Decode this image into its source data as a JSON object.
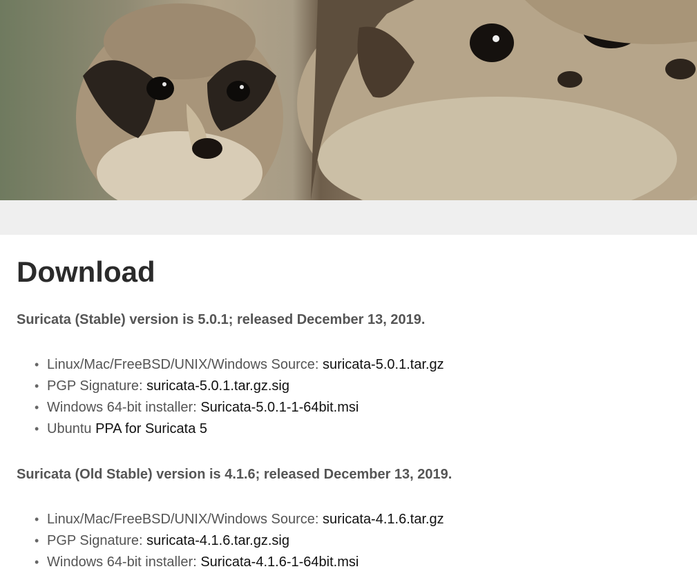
{
  "header": {
    "banner_alt": "meerkats"
  },
  "page": {
    "title": "Download"
  },
  "releases": [
    {
      "heading": "Suricata (Stable) version is 5.0.1; released December 13, 2019.",
      "items": [
        {
          "label": "Linux/Mac/FreeBSD/UNIX/Windows Source: ",
          "link": "suricata-5.0.1.tar.gz"
        },
        {
          "label": "PGP Signature: ",
          "link": "suricata-5.0.1.tar.gz.sig"
        },
        {
          "label": "Windows 64-bit installer: ",
          "link": "Suricata-5.0.1-1-64bit.msi"
        },
        {
          "label": "Ubuntu ",
          "link": "PPA for Suricata 5"
        }
      ]
    },
    {
      "heading": "Suricata (Old Stable) version is 4.1.6; released December 13, 2019.",
      "items": [
        {
          "label": "Linux/Mac/FreeBSD/UNIX/Windows Source: ",
          "link": "suricata-4.1.6.tar.gz"
        },
        {
          "label": "PGP Signature: ",
          "link": "suricata-4.1.6.tar.gz.sig"
        },
        {
          "label": "Windows 64-bit installer: ",
          "link": "Suricata-4.1.6-1-64bit.msi"
        }
      ]
    }
  ],
  "colors": {
    "title": "#2b2b2b",
    "label": "#555555",
    "link": "#111111",
    "band": "#efefef"
  }
}
